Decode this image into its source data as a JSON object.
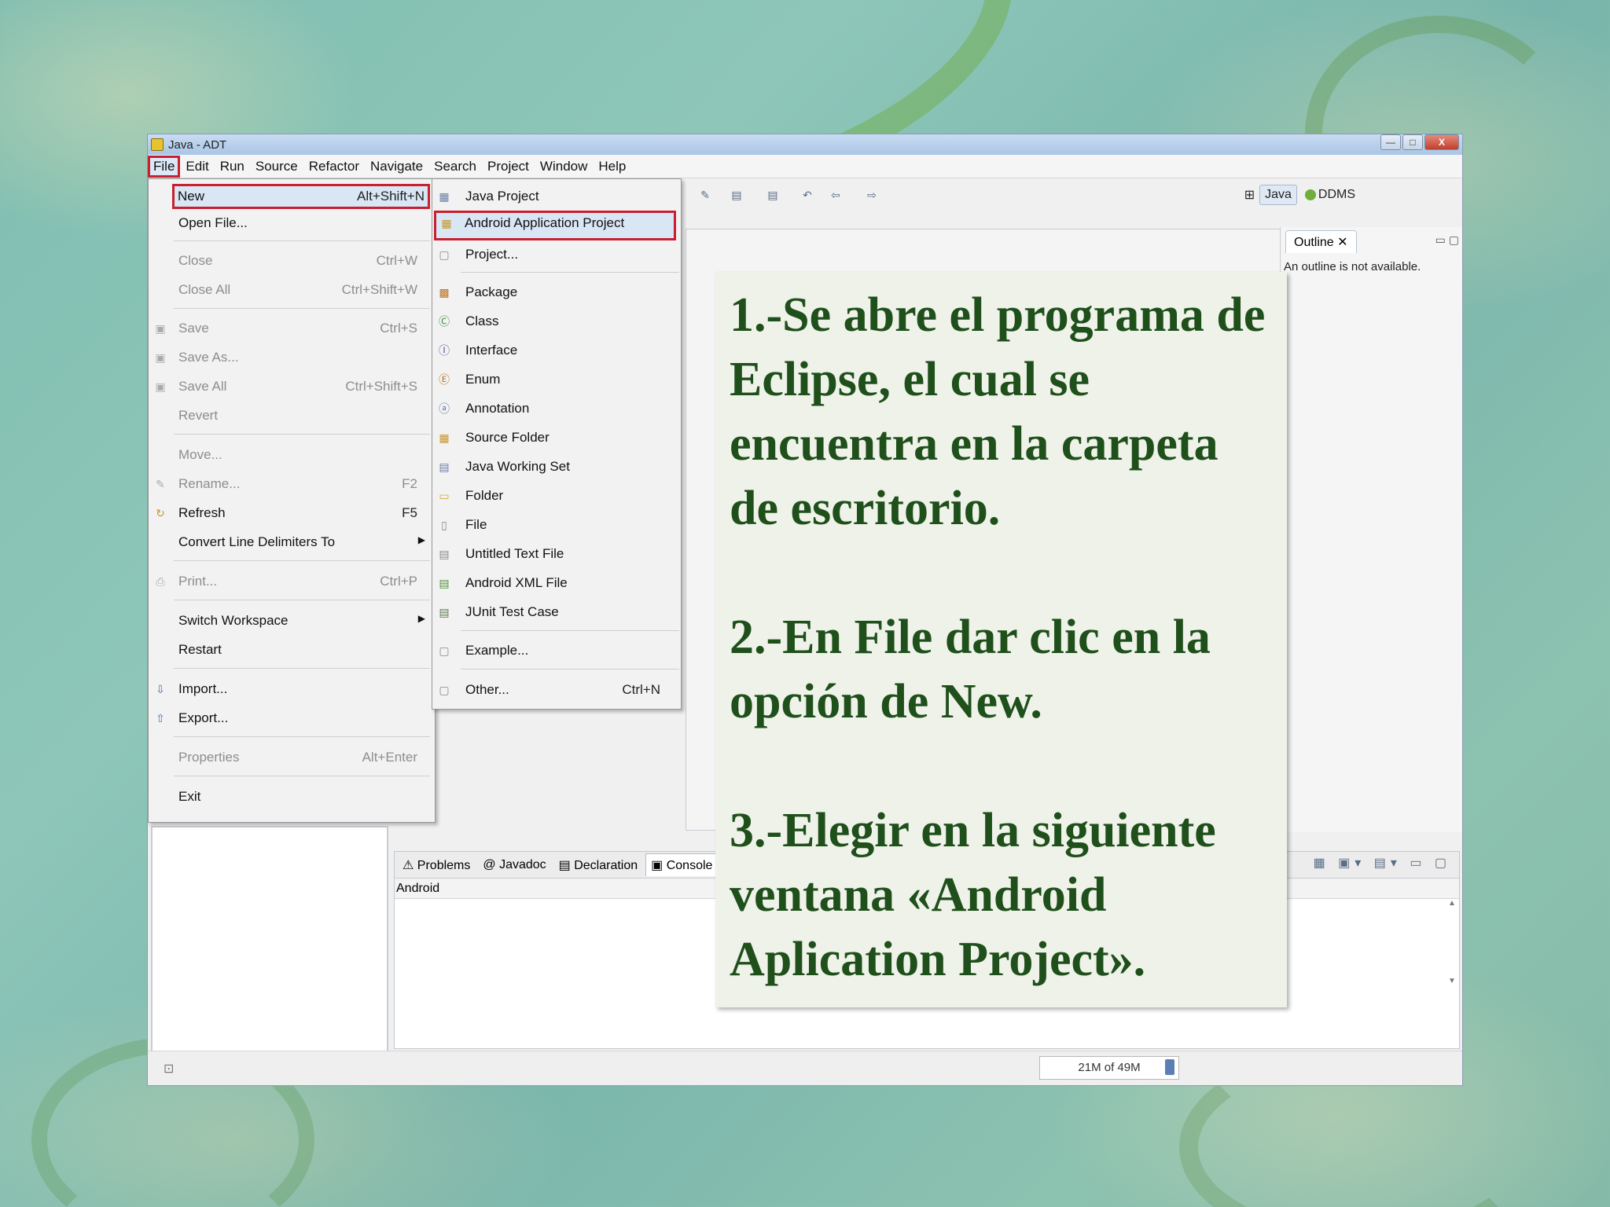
{
  "window": {
    "title": "Java - ADT",
    "controls": [
      "—",
      "□",
      "X"
    ]
  },
  "menubar": {
    "items": [
      "File",
      "Edit",
      "Run",
      "Source",
      "Refactor",
      "Navigate",
      "Search",
      "Project",
      "Window",
      "Help"
    ]
  },
  "perspectives": {
    "java": "Java",
    "ddms": "DDMS"
  },
  "file_menu": {
    "items": [
      {
        "label": "New",
        "shortcut": "Alt+Shift+N"
      },
      {
        "label": "Open File..."
      },
      {
        "label": "Close",
        "shortcut": "Ctrl+W"
      },
      {
        "label": "Close All",
        "shortcut": "Ctrl+Shift+W"
      },
      {
        "label": "Save",
        "shortcut": "Ctrl+S"
      },
      {
        "label": "Save As..."
      },
      {
        "label": "Save All",
        "shortcut": "Ctrl+Shift+S"
      },
      {
        "label": "Revert"
      },
      {
        "label": "Move..."
      },
      {
        "label": "Rename...",
        "shortcut": "F2"
      },
      {
        "label": "Refresh",
        "shortcut": "F5"
      },
      {
        "label": "Convert Line Delimiters To"
      },
      {
        "label": "Print...",
        "shortcut": "Ctrl+P"
      },
      {
        "label": "Switch Workspace"
      },
      {
        "label": "Restart"
      },
      {
        "label": "Import..."
      },
      {
        "label": "Export..."
      },
      {
        "label": "Properties",
        "shortcut": "Alt+Enter"
      },
      {
        "label": "Exit"
      }
    ]
  },
  "new_menu": {
    "items": [
      {
        "label": "Java Project"
      },
      {
        "label": "Android Application Project"
      },
      {
        "label": "Project..."
      },
      {
        "label": "Package"
      },
      {
        "label": "Class"
      },
      {
        "label": "Interface"
      },
      {
        "label": "Enum"
      },
      {
        "label": "Annotation"
      },
      {
        "label": "Source Folder"
      },
      {
        "label": "Java Working Set"
      },
      {
        "label": "Folder"
      },
      {
        "label": "File"
      },
      {
        "label": "Untitled Text File"
      },
      {
        "label": "Android XML File"
      },
      {
        "label": "JUnit Test Case"
      },
      {
        "label": "Example..."
      },
      {
        "label": "Other...",
        "shortcut": "Ctrl+N"
      }
    ]
  },
  "outline": {
    "tab": "Outline",
    "message": "An outline is not available."
  },
  "bottom_panel": {
    "tabs": [
      "Problems",
      "Javadoc",
      "Declaration",
      "Console"
    ],
    "console_name": "Android"
  },
  "status": {
    "heap": "21M of 49M"
  },
  "note": {
    "step1": "1.-Se abre el programa de Eclipse, el cual se encuentra en la carpeta de escritorio.",
    "step2": "2.-En File dar clic en la opción de New.",
    "step3": "3.-Elegir en la siguiente ventana «Android Aplication Project»."
  },
  "colors": {
    "highlight_border": "#c82030",
    "note_text": "#1f4f1b",
    "note_bg": "#eef2e8"
  }
}
